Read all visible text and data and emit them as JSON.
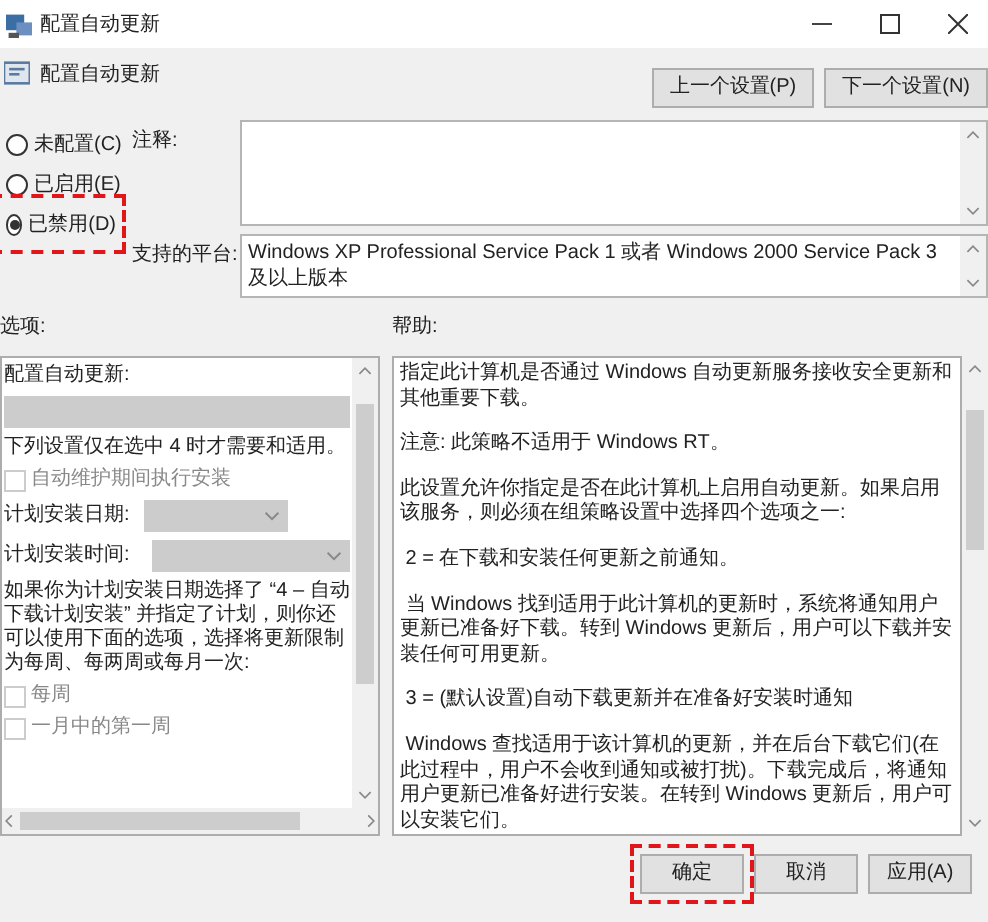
{
  "window": {
    "title": "配置自动更新"
  },
  "header": {
    "title": "配置自动更新",
    "buttons": [
      "上一个设置(P)",
      "下一个设置(N)"
    ]
  },
  "state_options": [
    {
      "label": "未配置(C)",
      "selected": false,
      "highlighted": false
    },
    {
      "label": "已启用(E)",
      "selected": false,
      "highlighted": false
    },
    {
      "label": "已禁用(D)",
      "selected": true,
      "highlighted": true
    }
  ],
  "comment": {
    "label": "注释:"
  },
  "platform": {
    "label": "支持的平台:",
    "lines": [
      "Windows XP Professional Service Pack 1 或者 Windows 2000 Service Pack 3 及以上版本"
    ]
  },
  "options": {
    "label": "选项:",
    "items": [
      {
        "kind": "text",
        "text": "配置自动更新:"
      },
      {
        "kind": "dropdown",
        "disabled": true
      },
      {
        "kind": "text",
        "text": "下列设置仅在选中 4 时才需要和适用。"
      },
      {
        "kind": "checkbox",
        "text": "自动维护期间执行安装",
        "checked": false,
        "disabled": true
      },
      {
        "kind": "labeled_dropdown",
        "text": "计划安装日期:",
        "disabled": true
      },
      {
        "kind": "labeled_dropdown",
        "text": "计划安装时间:",
        "disabled": true
      },
      {
        "kind": "text",
        "text": "如果你为计划安装日期选择了 “4 – 自动下载计划安装” 并指定了计划，则你还可以使用下面的选项，选择将更新限制为每周、每两周或每月一次:"
      },
      {
        "kind": "checkbox",
        "text": "每周",
        "checked": false,
        "disabled": true
      },
      {
        "kind": "checkbox",
        "text": "一月中的第一周",
        "checked": false,
        "disabled": true
      }
    ]
  },
  "help": {
    "label": "帮助:",
    "paragraphs": [
      "指定此计算机是否通过 Windows 自动更新服务接收安全更新和其他重要下载。",
      "注意: 此策略不适用于 Windows RT。",
      "此设置允许你指定是否在此计算机上启用自动更新。如果启用该服务，则必须在组策略设置中选择四个选项之一:",
      " 2 = 在下载和安装任何更新之前通知。",
      " 当 Windows 找到适用于此计算机的更新时，系统将通知用户更新已准备好下载。转到 Windows 更新后，用户可以下载并安装任何可用更新。",
      " 3 = (默认设置)自动下载更新并在准备好安装时通知",
      " Windows 查找适用于该计算机的更新，并在后台下载它们(在此过程中，用户不会收到通知或被打扰)。下载完成后，将通知用户更新已准备好进行安装。在转到 Windows 更新后，用户可以安装它们。"
    ]
  },
  "footer": {
    "buttons": [
      {
        "label": "确定",
        "highlighted": true
      },
      {
        "label": "取消",
        "highlighted": false
      },
      {
        "label": "应用(A)",
        "highlighted": false
      }
    ]
  }
}
